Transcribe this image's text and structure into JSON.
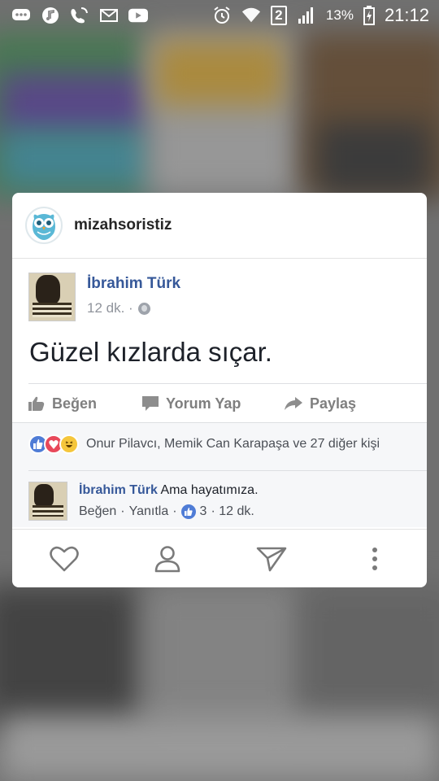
{
  "status_bar": {
    "battery_percent": "13%",
    "time": "21:12",
    "sim_number": "2",
    "left_icons": [
      "messages-icon",
      "music-icon",
      "wifi-calling-icon",
      "mail-icon",
      "youtube-icon"
    ],
    "right_icons": [
      "alarm-icon",
      "wifi-icon",
      "signal-icon",
      "battery-charging-icon"
    ]
  },
  "card": {
    "account_name": "mizahsoristiz",
    "post": {
      "author": "İbrahim Türk",
      "time": "12 dk. ·",
      "text": "Güzel kızlarda sıçar.",
      "actions": {
        "like": "Beğen",
        "comment": "Yorum Yap",
        "share": "Paylaş"
      },
      "reactions_text": "Onur Pilavcı, Memik Can Karapaşa ve 27 diğer kişi",
      "comment": {
        "author": "İbrahim Türk",
        "text": " Ama hayatımıza.",
        "like": "Beğen",
        "sep1": "·",
        "reply": "Yanıtla",
        "sep2": "·",
        "likes": "3",
        "time": "· 12 dk."
      }
    },
    "footer_icons": [
      "heart-icon",
      "profile-icon",
      "send-icon",
      "more-icon"
    ]
  },
  "colors": {
    "link_blue": "#365899",
    "fb_like_blue": "#4f7cd6",
    "fb_love_red": "#e8485a",
    "fb_haha_yellow": "#f5c63b"
  }
}
